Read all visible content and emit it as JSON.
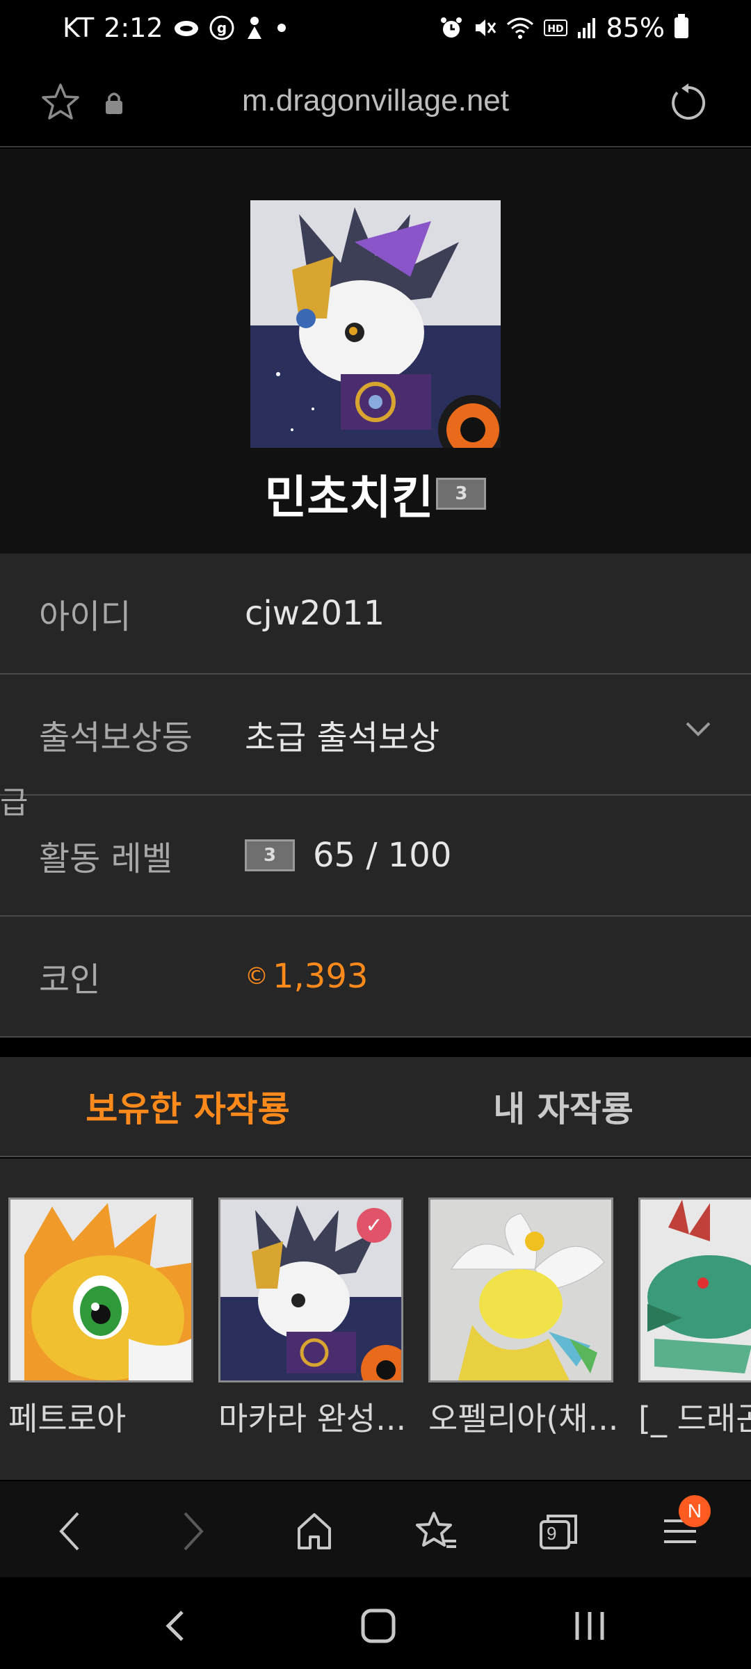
{
  "status_bar": {
    "carrier": "KT",
    "time": "2:12",
    "battery": "85%",
    "icons_left": [
      "cloud-icon",
      "g-app-icon",
      "figure-app-icon",
      "dot-icon"
    ],
    "icons_right": [
      "alarm-icon",
      "mute-icon",
      "wifi-icon",
      "hd-icon",
      "signal-icon",
      "battery-icon"
    ]
  },
  "browser": {
    "url": "m.dragonvillage.net"
  },
  "profile": {
    "nickname": "민초치킨",
    "level_badge": "3"
  },
  "info": {
    "id_label": "아이디",
    "id_value": "cjw2011",
    "attendance_label_line1": "출석보상등",
    "attendance_label_line2": "급",
    "attendance_value": "초급 출석보상",
    "activity_label": "활동 레벨",
    "activity_badge": "3",
    "activity_value": "65 / 100",
    "coin_label": "코인",
    "coin_symbol": "©",
    "coin_value": "1,393"
  },
  "tabs": {
    "owned": "보유한 자작룡",
    "mine": "내 자작룡"
  },
  "dragons": [
    {
      "name": "페트로아"
    },
    {
      "name": "마카라 완성..."
    },
    {
      "name": "오펠리아(채..."
    },
    {
      "name": "[_ 드래곤"
    }
  ],
  "browser_nav": {
    "notification_badge": "N",
    "tab_count": "9"
  },
  "colors": {
    "accent": "#ff8a1c",
    "background": "#262626",
    "header_bg": "#111111",
    "check_badge": "#e05368"
  }
}
